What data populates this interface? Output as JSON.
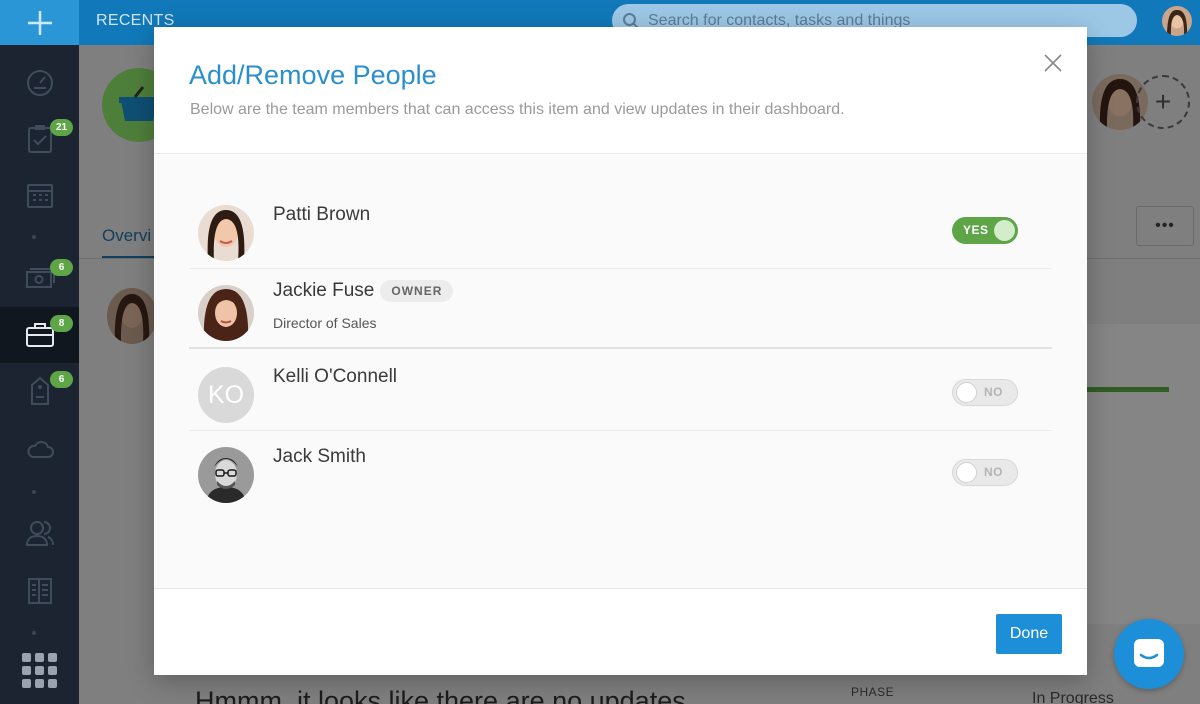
{
  "topbar": {
    "recents_label": "RECENTS",
    "search_placeholder": "Search for contacts, tasks and things"
  },
  "sidebar": {
    "items": [
      {
        "icon": "dashboard-gauge-icon",
        "badge": ""
      },
      {
        "icon": "tasks-clipboard-icon",
        "badge": "21"
      },
      {
        "icon": "calendar-icon",
        "badge": ""
      },
      {
        "icon": "money-icon",
        "badge": "6"
      },
      {
        "icon": "briefcase-icon",
        "badge": "8"
      },
      {
        "icon": "tag-icon",
        "badge": "6"
      },
      {
        "icon": "cloud-icon",
        "badge": ""
      },
      {
        "icon": "contacts-icon",
        "badge": ""
      },
      {
        "icon": "reports-icon",
        "badge": ""
      },
      {
        "icon": "apps-grid-icon",
        "badge": ""
      }
    ]
  },
  "background": {
    "tab_label": "Overvi",
    "more_label": "•••",
    "empty_text": "Hmmm, it looks like there are no updates",
    "phase_label": "PHASE",
    "phase_value": "In Progress"
  },
  "modal": {
    "title": "Add/Remove People",
    "subtitle": "Below are the team members that can access this item and view updates in their dashboard.",
    "people": [
      {
        "name": "Patti Brown",
        "title": "",
        "owner": false,
        "access": true,
        "toggle_label": "YES",
        "initials": ""
      },
      {
        "name": "Jackie Fuse",
        "title": "Director of Sales",
        "owner": true,
        "owner_label": "OWNER",
        "initials": ""
      },
      {
        "name": "Kelli O'Connell",
        "title": "",
        "owner": false,
        "access": false,
        "toggle_label": "NO",
        "initials": "KO"
      },
      {
        "name": "Jack Smith",
        "title": "",
        "owner": false,
        "access": false,
        "toggle_label": "NO",
        "initials": ""
      }
    ],
    "done_label": "Done"
  },
  "colors": {
    "accent": "#1c8fd8",
    "title_blue": "#2b8fcb",
    "toggle_on": "#5ea547",
    "topbar": "#1179b9",
    "sidebar": "#1b2430"
  }
}
